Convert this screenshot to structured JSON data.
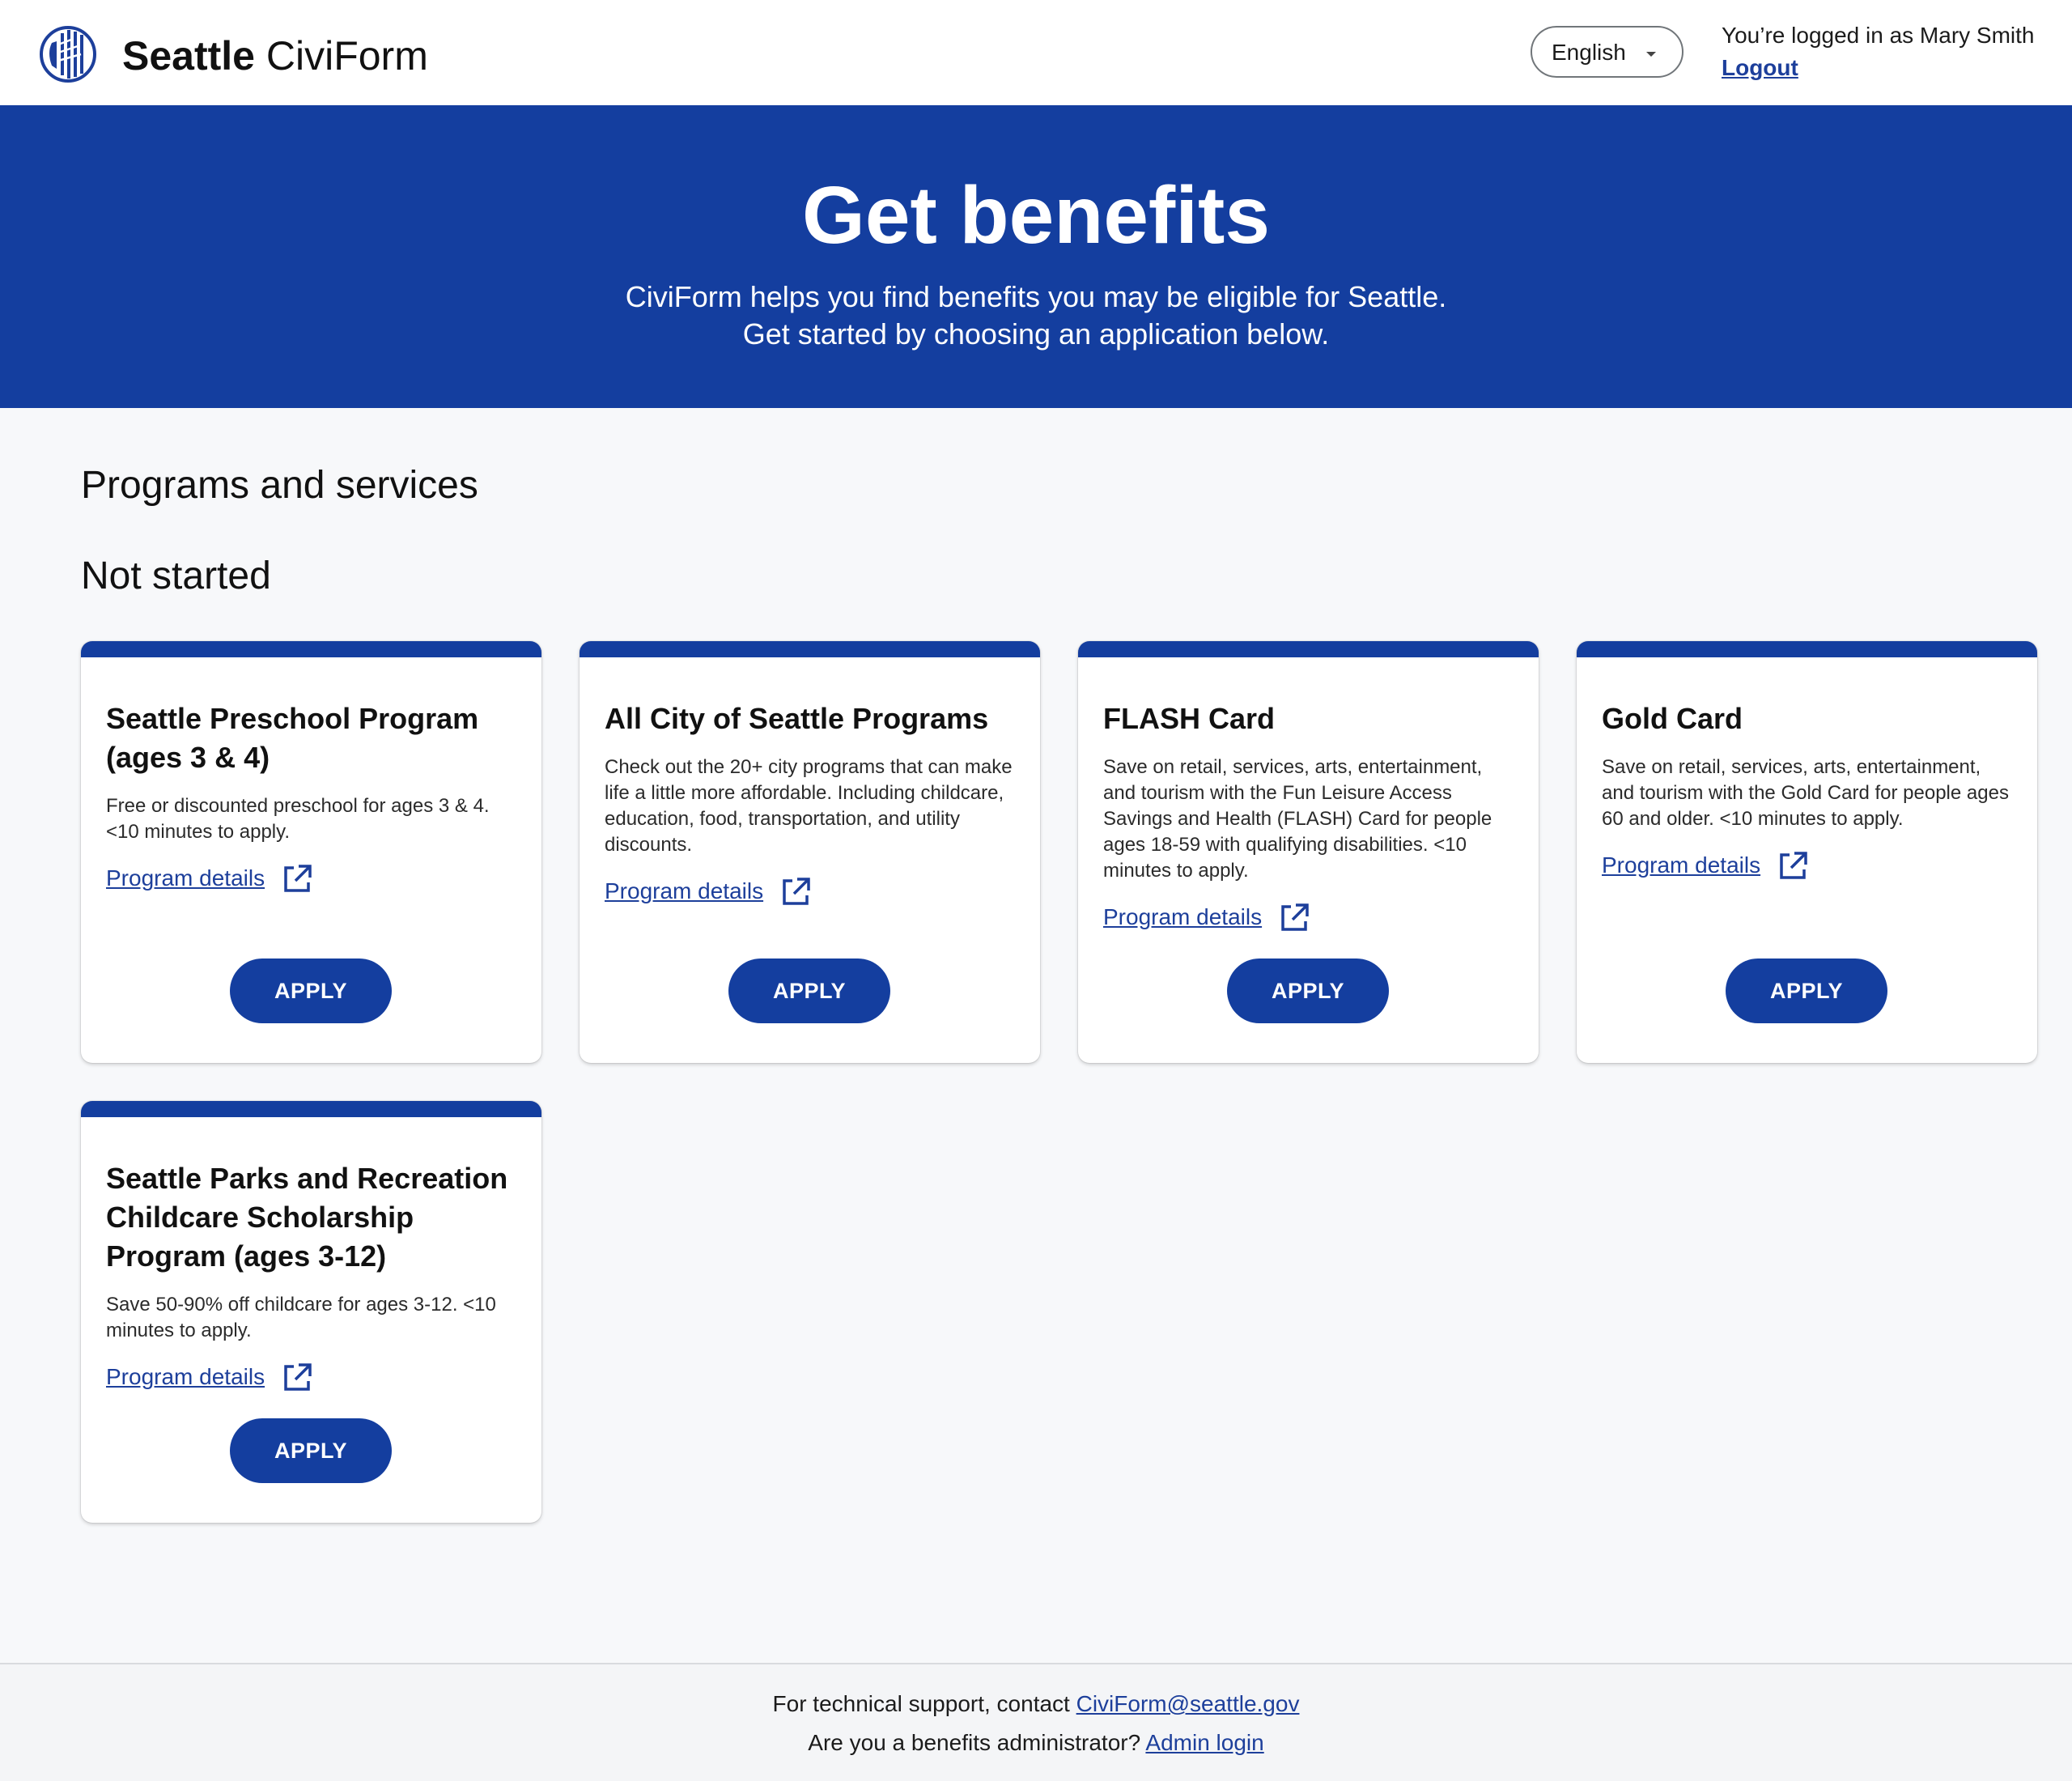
{
  "header": {
    "brand_bold": "Seattle",
    "brand_regular": "CiviForm",
    "language": "English",
    "logged_in_text": "You’re logged in as Mary Smith",
    "logout_label": "Logout"
  },
  "hero": {
    "title": "Get benefits",
    "subtitle_line1": "CiviForm helps you find benefits you may be eligible for Seattle.",
    "subtitle_line2": "Get started by choosing an application below."
  },
  "main": {
    "section_title": "Programs and services",
    "group_title": "Not started",
    "programs": [
      {
        "title": "Seattle Preschool Program (ages 3 & 4)",
        "description": "Free or discounted preschool for ages 3 & 4. <10 minutes to apply.",
        "details_label": "Program details",
        "apply_label": "APPLY"
      },
      {
        "title": "All City of Seattle Programs",
        "description": "Check out the 20+ city programs that can make life a little more affordable. Including childcare, education, food, transportation, and utility discounts.",
        "details_label": "Program details",
        "apply_label": "APPLY"
      },
      {
        "title": "FLASH Card",
        "description": "Save on retail, services, arts, entertainment, and tourism with the Fun Leisure Access Savings and Health (FLASH) Card for people ages 18-59 with qualifying disabilities. <10 minutes to apply.",
        "details_label": "Program details",
        "apply_label": "APPLY"
      },
      {
        "title": "Gold Card",
        "description": "Save on retail, services, arts, entertainment, and tourism with the Gold Card for people ages 60 and older. <10 minutes to apply.",
        "details_label": "Program details",
        "apply_label": "APPLY"
      },
      {
        "title": "Seattle Parks and Recreation Childcare Scholarship Program (ages 3-12)",
        "description": "Save 50-90% off childcare for ages 3-12. <10 minutes to apply.",
        "details_label": "Program details",
        "apply_label": "APPLY"
      }
    ]
  },
  "footer": {
    "support_text": "For technical support, contact ",
    "support_email": "CiviForm@seattle.gov",
    "admin_text": "Are you a benefits administrator? ",
    "admin_link": "Admin login"
  },
  "colors": {
    "brand_blue": "#143e9f",
    "link_blue": "#1d3f9b",
    "page_background": "#f7f8fa"
  },
  "icons": [
    "seattle-logo-icon",
    "chevron-down-icon",
    "external-link-icon"
  ]
}
